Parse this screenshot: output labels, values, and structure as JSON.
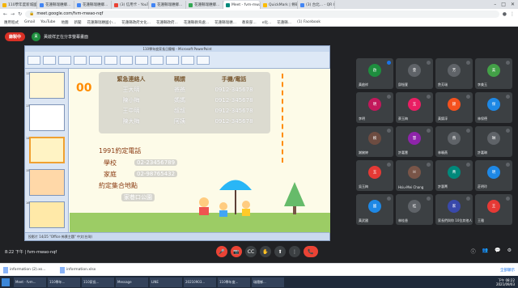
{
  "browser": {
    "tabs": [
      {
        "label": "110學年度新城國民...",
        "color": "#f4b400"
      },
      {
        "label": "花蓮縣瑞穗鄉...",
        "color": "#4285f4"
      },
      {
        "label": "花蓮縣瑞穗鄉...",
        "color": "#4285f4"
      },
      {
        "label": "(3) 信用卡 - YouTube",
        "color": "#ea4335"
      },
      {
        "label": "花蓮縣瑞穗鄉...",
        "color": "#4285f4"
      },
      {
        "label": "花蓮縣瑞穗鄉...",
        "color": "#34a853"
      },
      {
        "label": "Meet - fvm-mwao-nqf",
        "color": "#00897b"
      },
      {
        "label": "QuickMark | 條碼...",
        "color": "#fbbc04"
      },
      {
        "label": "(3) 台北... - QR Co...",
        "color": "#4285f4"
      }
    ],
    "url": "meet.google.com/fvm-mwao-nqf",
    "bookmarks": [
      "應用程式",
      "Gmail",
      "YouTube",
      "地圖",
      "新聞",
      "花蓮縣瑞穗國小...",
      "花蓮縣政府文化...",
      "花蓮縣政府...",
      "花蓮縣教育處...",
      "花蓮縣瑞穗...",
      "教育部...",
      "e化...",
      "花蓮縣...",
      "(1) Facebook"
    ]
  },
  "meet": {
    "recording_label": "錄製中",
    "presenter": "黃啟祥正在分享螢幕畫面",
    "presenter_initial": "黃",
    "time_code": "8:22 下午 | fvm-mwao-nqf",
    "participants": [
      {
        "name": "黃啟祥",
        "initial": "啟",
        "color": "#1e8e3e",
        "speaking": true
      },
      {
        "name": "邱愷萱",
        "initial": "萱",
        "color": "#5f6368",
        "speaking": false
      },
      {
        "name": "詹芳瑞",
        "initial": "芳",
        "color": "#5f6368",
        "speaking": false
      },
      {
        "name": "李美玉",
        "initial": "美",
        "color": "#43a047",
        "speaking": false
      },
      {
        "name": "李明",
        "initial": "明",
        "color": "#c2185b",
        "speaking": false
      },
      {
        "name": "蔡玉梅",
        "initial": "玉",
        "color": "#e91e63",
        "speaking": false
      },
      {
        "name": "黃錦淳",
        "initial": "錦",
        "color": "#f4511e",
        "speaking": false
      },
      {
        "name": "林保德",
        "initial": "保",
        "color": "#1e88e5",
        "speaking": false
      },
      {
        "name": "謝婉婷",
        "initial": "婉",
        "color": "#6d4c41",
        "speaking": false
      },
      {
        "name": "許嘉慧",
        "initial": "慧",
        "color": "#8e24aa",
        "speaking": false
      },
      {
        "name": "林曉燕",
        "initial": "燕",
        "color": "#5f6368",
        "speaking": false
      },
      {
        "name": "許嘉琳",
        "initial": "琳",
        "color": "#5f6368",
        "speaking": false
      },
      {
        "name": "吳玉梅",
        "initial": "玉",
        "color": "#e53935",
        "speaking": false
      },
      {
        "name": "Hsiu-Mei Chang",
        "initial": "H",
        "color": "#795548",
        "speaking": false
      },
      {
        "name": "許惠菁",
        "initial": "菁",
        "color": "#00897b",
        "speaking": false
      },
      {
        "name": "莊明玲",
        "initial": "明",
        "color": "#1e88e5",
        "speaking": false
      },
      {
        "name": "黃武國",
        "initial": "國",
        "color": "#1e88e5",
        "speaking": false
      },
      {
        "name": "林桂香",
        "initial": "桂",
        "color": "#5f6368",
        "speaking": false
      },
      {
        "name": "家長們與你 10位其他人",
        "initial": "家",
        "color": "#3949ab",
        "speaking": false
      },
      {
        "name": "王雅",
        "initial": "王",
        "color": "#e53935",
        "speaking": false
      }
    ],
    "controls": {
      "mic": "🎤",
      "cam": "📷",
      "cc": "CC",
      "hand": "✋",
      "present": "⬆",
      "more": "⋮",
      "end": "📞"
    },
    "right_controls": [
      "ⓘ",
      "👥",
      "💬",
      "⚙"
    ]
  },
  "ppt": {
    "window_title": "110學年度家長日簡報 - Microsoft PowerPoint",
    "statusbar": "投影片 14/25   \"Office 佈景主題\"   中文(台灣)",
    "notes_placeholder": "按一下以新增備忘稿",
    "slide": {
      "big_o": "00",
      "table_head": [
        "緊急連絡人",
        "稱謂",
        "手機/電話"
      ],
      "table_rows": [
        [
          "王大明",
          "爸爸",
          "0912-345678"
        ],
        [
          "陳小梅",
          "媽媽",
          "0912-345678"
        ],
        [
          "王中明",
          "叔叔",
          "0912-345678"
        ],
        [
          "陳大梅",
          "阿姨",
          "0912-345678"
        ]
      ],
      "call_title": "1991約定電話",
      "school_label": "學校",
      "school_phone": "02-23456789",
      "home_label": "家庭",
      "home_phone": "02-98765432",
      "meeting_title": "約定集合地點",
      "meeting_place": "家巷口公園"
    },
    "thumbs": [
      {
        "num": "12",
        "color": "#fff6d5"
      },
      {
        "num": "13",
        "color": "#ffffff"
      },
      {
        "num": "14",
        "color": "#fff3c4"
      },
      {
        "num": "15",
        "color": "#ffd8a8"
      },
      {
        "num": "16",
        "color": "#ffe9a8"
      }
    ]
  },
  "downloads": [
    {
      "name": "information (2).xs..."
    },
    {
      "name": "information.xlsx"
    }
  ],
  "downloads_all": "全部顯示",
  "taskbar": {
    "items": [
      "Meet - fvm...",
      "110學年...",
      "110家長...",
      "Message",
      "LINE",
      "20210903...",
      "110學年度...",
      "瑞穗鄉..."
    ],
    "clock_time": "下午 08:22",
    "clock_date": "2021/09/03"
  }
}
